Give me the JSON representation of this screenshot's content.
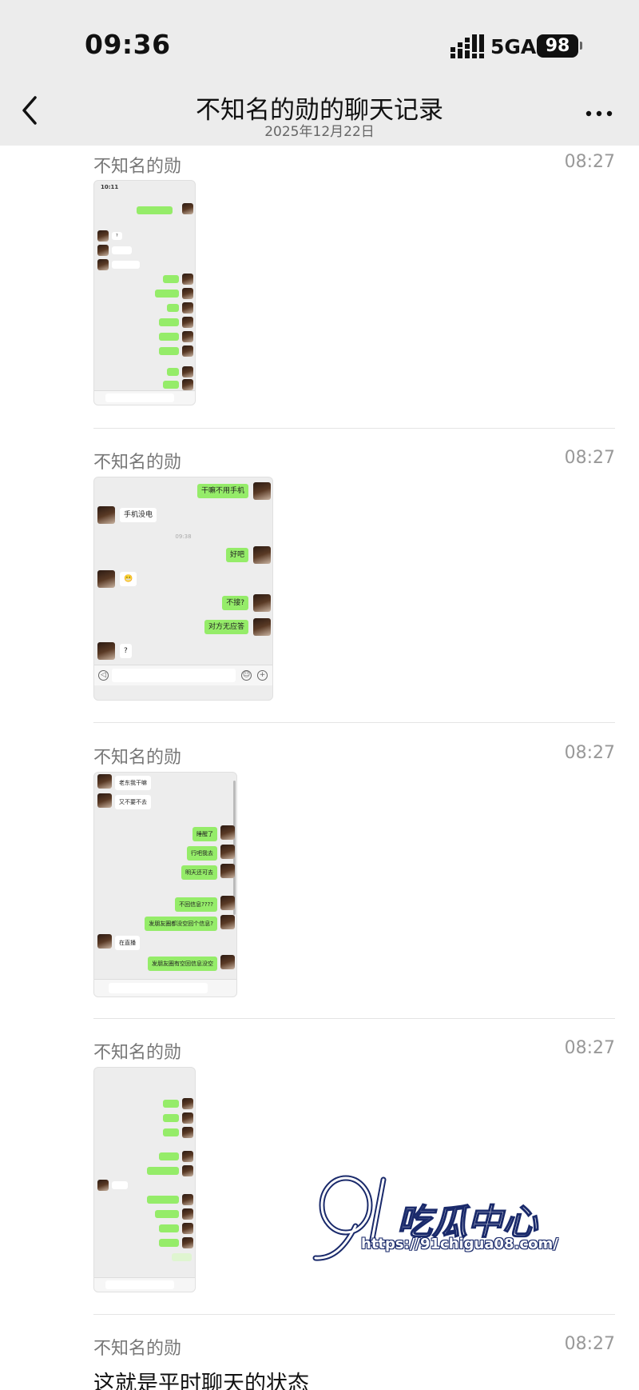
{
  "status": {
    "time": "09:36",
    "network": "5GA",
    "battery": "98"
  },
  "nav": {
    "title": "不知名的勋的聊天记录",
    "date": "2025年12月22日"
  },
  "messages": [
    {
      "sender": "不知名的勋",
      "time": "08:27",
      "type": "image"
    },
    {
      "sender": "不知名的勋",
      "time": "08:27",
      "type": "image",
      "bubbles": [
        "干嘛不用手机",
        "手机没电",
        "09:38",
        "好吧",
        "😬",
        "不接?",
        "对方无应答",
        "?"
      ]
    },
    {
      "sender": "不知名的勋",
      "time": "08:27",
      "type": "image",
      "bubbles": [
        "老东我干嘛",
        "又不要不去",
        "睡醒了",
        "行吧我去",
        "明天还可去",
        "不回信息????",
        "发朋友圈都没空回个信息?",
        "在直播",
        "发朋友圈有空回信息没空"
      ]
    },
    {
      "sender": "不知名的勋",
      "time": "08:27",
      "type": "image"
    },
    {
      "sender": "不知名的勋",
      "time": "08:27",
      "type": "text",
      "text": "这就是平时聊天的状态"
    }
  ],
  "watermark": {
    "url": "https://91chigua08.com/"
  },
  "icons": [
    "back-icon",
    "more-icon",
    "signal-icon",
    "battery-icon"
  ],
  "colors": {
    "bubble_green": "#95ec69",
    "chat_bg": "#ededed",
    "topbar": "#ececec"
  }
}
